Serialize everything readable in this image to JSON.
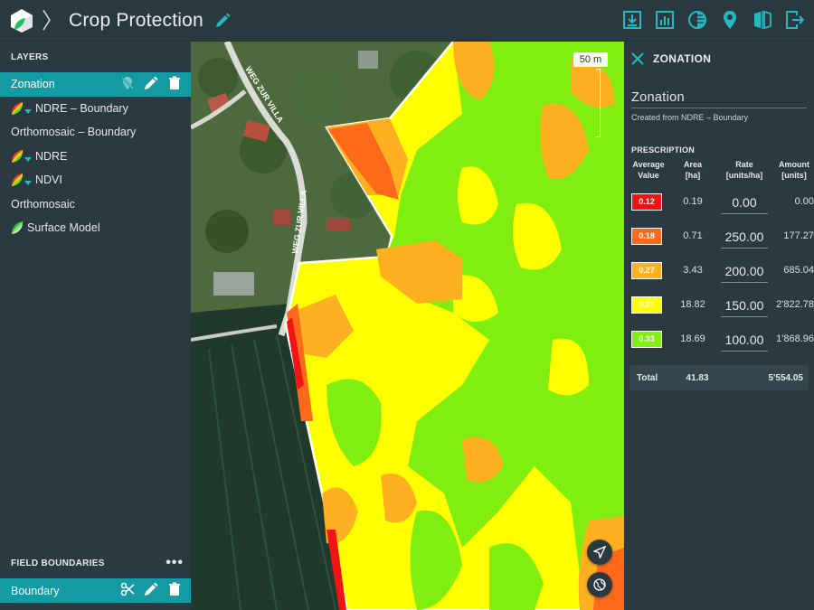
{
  "header": {
    "title": "Crop Protection",
    "separator": "〉"
  },
  "layers_panel": {
    "title": "LAYERS",
    "items": [
      {
        "label": "Zonation",
        "active": true,
        "leaf": false
      },
      {
        "label": "NDRE – Boundary",
        "active": false,
        "leaf": true
      },
      {
        "label": "Orthomosaic – Boundary",
        "active": false,
        "leaf": false
      },
      {
        "label": "NDRE",
        "active": false,
        "leaf": true
      },
      {
        "label": "NDVI",
        "active": false,
        "leaf": true
      },
      {
        "label": "Orthomosaic",
        "active": false,
        "leaf": false
      },
      {
        "label": "Surface Model",
        "active": false,
        "leaf": true
      }
    ]
  },
  "field_boundaries": {
    "title": "FIELD BOUNDARIES",
    "more": "•••",
    "items": [
      {
        "label": "Boundary",
        "active": true
      }
    ]
  },
  "map": {
    "road_label": "WEG ZUR VILLA",
    "scale_label": "50 m"
  },
  "zonation_panel": {
    "title": "ZONATION",
    "name": "Zonation",
    "subtitle": "Created from NDRE – Boundary",
    "section": "PRESCRIPTION",
    "columns": {
      "avg": [
        "Average",
        "Value"
      ],
      "area": [
        "Area",
        "[ha]"
      ],
      "rate": [
        "Rate",
        "[units/ha]"
      ],
      "amount": [
        "Amount",
        "[units]"
      ]
    },
    "rows": [
      {
        "avg": "0.12",
        "area": "0.19",
        "rate": "0.00",
        "amount": "0.00",
        "color": "#f01414",
        "text_color": "#ffffff"
      },
      {
        "avg": "0.18",
        "area": "0.71",
        "rate": "250.00",
        "amount": "177.27",
        "color": "#ff6a1a",
        "text_color": "#ffffff"
      },
      {
        "avg": "0.27",
        "area": "3.43",
        "rate": "200.00",
        "amount": "685.04",
        "color": "#ffb020",
        "text_color": "#ffffff"
      },
      {
        "avg": "0.31",
        "area": "18.82",
        "rate": "150.00",
        "amount": "2'822.78",
        "color": "#ffff00",
        "text_color": "#ffffff"
      },
      {
        "avg": "0.33",
        "area": "18.69",
        "rate": "100.00",
        "amount": "1'868.96",
        "color": "#80ef10",
        "text_color": "#ffffff"
      }
    ],
    "total": {
      "label": "Total",
      "area": "41.83",
      "amount": "5'554.05"
    }
  },
  "colors": {
    "accent": "#149aa3",
    "panel_bg": "#2b3a40"
  }
}
